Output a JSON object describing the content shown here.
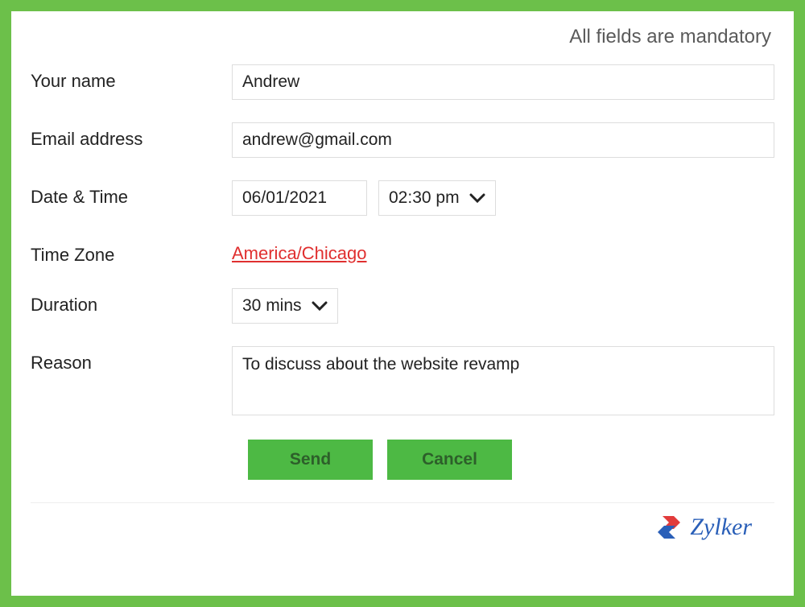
{
  "notice": "All fields are mandatory",
  "form": {
    "name": {
      "label": "Your name",
      "value": "Andrew"
    },
    "email": {
      "label": "Email address",
      "value": "andrew@gmail.com"
    },
    "datetime": {
      "label": "Date & Time",
      "date_value": "06/01/2021",
      "time_value": "02:30 pm"
    },
    "timezone": {
      "label": "Time Zone",
      "value": "America/Chicago"
    },
    "duration": {
      "label": "Duration",
      "value": "30 mins"
    },
    "reason": {
      "label": "Reason",
      "value": "To discuss about the website revamp"
    }
  },
  "buttons": {
    "send": "Send",
    "cancel": "Cancel"
  },
  "brand": "Zylker"
}
